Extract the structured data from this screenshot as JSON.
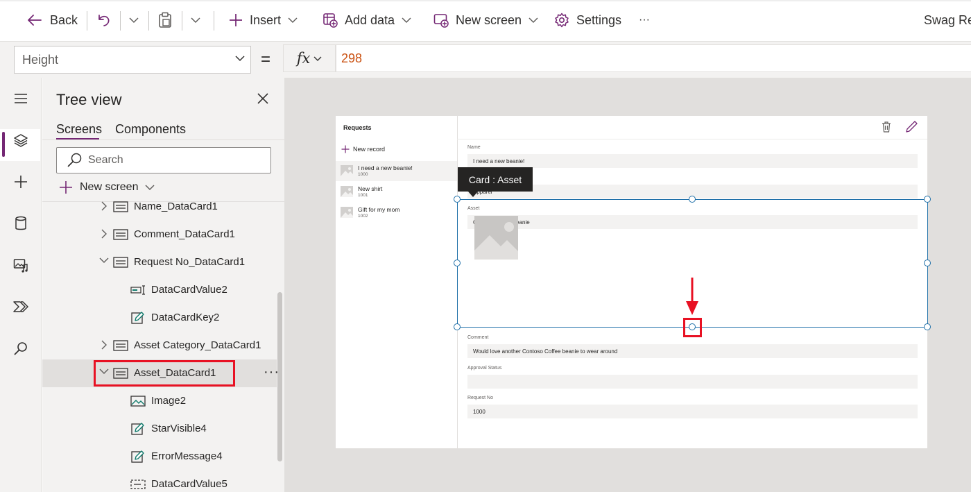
{
  "command_bar": {
    "back": "Back",
    "insert": "Insert",
    "add_data": "Add data",
    "new_screen": "New screen",
    "settings": "Settings",
    "more": "···",
    "app_name": "Swag Re"
  },
  "formula_bar": {
    "property": "Height",
    "equals": "=",
    "fx": "fx",
    "formula": "298"
  },
  "tree_view": {
    "title": "Tree view",
    "tabs": [
      "Screens",
      "Components"
    ],
    "search_placeholder": "Search",
    "new_screen": "New screen",
    "nodes": {
      "name_card": "Name_DataCard1",
      "comment_card": "Comment_DataCard1",
      "request_no_card": "Request No_DataCard1",
      "datacardvalue2": "DataCardValue2",
      "datacardkey2": "DataCardKey2",
      "asset_category_card": "Asset Category_DataCard1",
      "asset_card": "Asset_DataCard1",
      "image2": "Image2",
      "starvisible4": "StarVisible4",
      "errormessage4": "ErrorMessage4",
      "datacardvalue5": "DataCardValue5"
    },
    "more": "···"
  },
  "app_preview": {
    "title": "Requests",
    "new_record": "New record",
    "gallery": [
      {
        "title": "I need a new beanie!",
        "sub": "1000"
      },
      {
        "title": "New shirt",
        "sub": "1001"
      },
      {
        "title": "Gift for my mom",
        "sub": "1002"
      }
    ],
    "form": {
      "name_label": "Name",
      "name_value": "I need a new beanie!",
      "category_value": "Apparel",
      "asset_label": "Asset",
      "asset_value": "Contoso Coffee beanie",
      "comment_label": "Comment",
      "comment_value": "Would love another Contoso Coffee beanie to wear around",
      "approval_label": "Approval Status",
      "approval_value": "",
      "request_no_label": "Request No",
      "request_no_value": "1000"
    },
    "tooltip": "Card : Asset"
  },
  "colors": {
    "accent": "#742774",
    "highlight": "#e81123",
    "selection": "#1e6fa8",
    "formula_text": "#ca5010"
  }
}
